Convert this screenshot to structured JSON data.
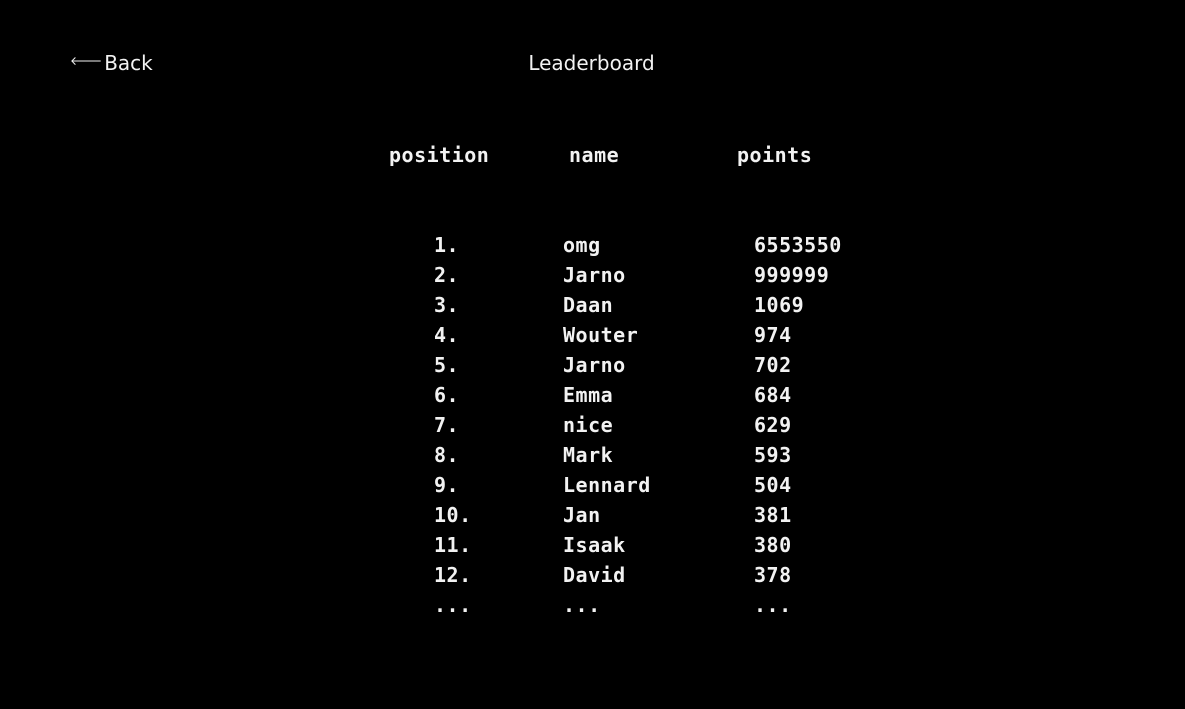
{
  "header": {
    "back_label": "Back",
    "title": "Leaderboard"
  },
  "table": {
    "columns": [
      "position",
      "name",
      "points"
    ],
    "rows": [
      {
        "position": "1.",
        "name": "omg",
        "points": "6553550"
      },
      {
        "position": "2.",
        "name": "Jarno",
        "points": "999999"
      },
      {
        "position": "3.",
        "name": "Daan",
        "points": "1069"
      },
      {
        "position": "4.",
        "name": "Wouter",
        "points": "974"
      },
      {
        "position": "5.",
        "name": "Jarno",
        "points": "702"
      },
      {
        "position": "6.",
        "name": "Emma",
        "points": "684"
      },
      {
        "position": "7.",
        "name": "nice",
        "points": "629"
      },
      {
        "position": "8.",
        "name": "Mark",
        "points": "593"
      },
      {
        "position": "9.",
        "name": "Lennard",
        "points": "504"
      },
      {
        "position": "10.",
        "name": "Jan",
        "points": "381"
      },
      {
        "position": "11.",
        "name": "Isaak",
        "points": "380"
      },
      {
        "position": "12.",
        "name": "David",
        "points": "378"
      },
      {
        "position": "...",
        "name": "...",
        "points": "..."
      }
    ]
  },
  "icons": {
    "back": "arrow-left-icon"
  },
  "colors": {
    "background": "#000000",
    "text": "#f2f2f2"
  }
}
